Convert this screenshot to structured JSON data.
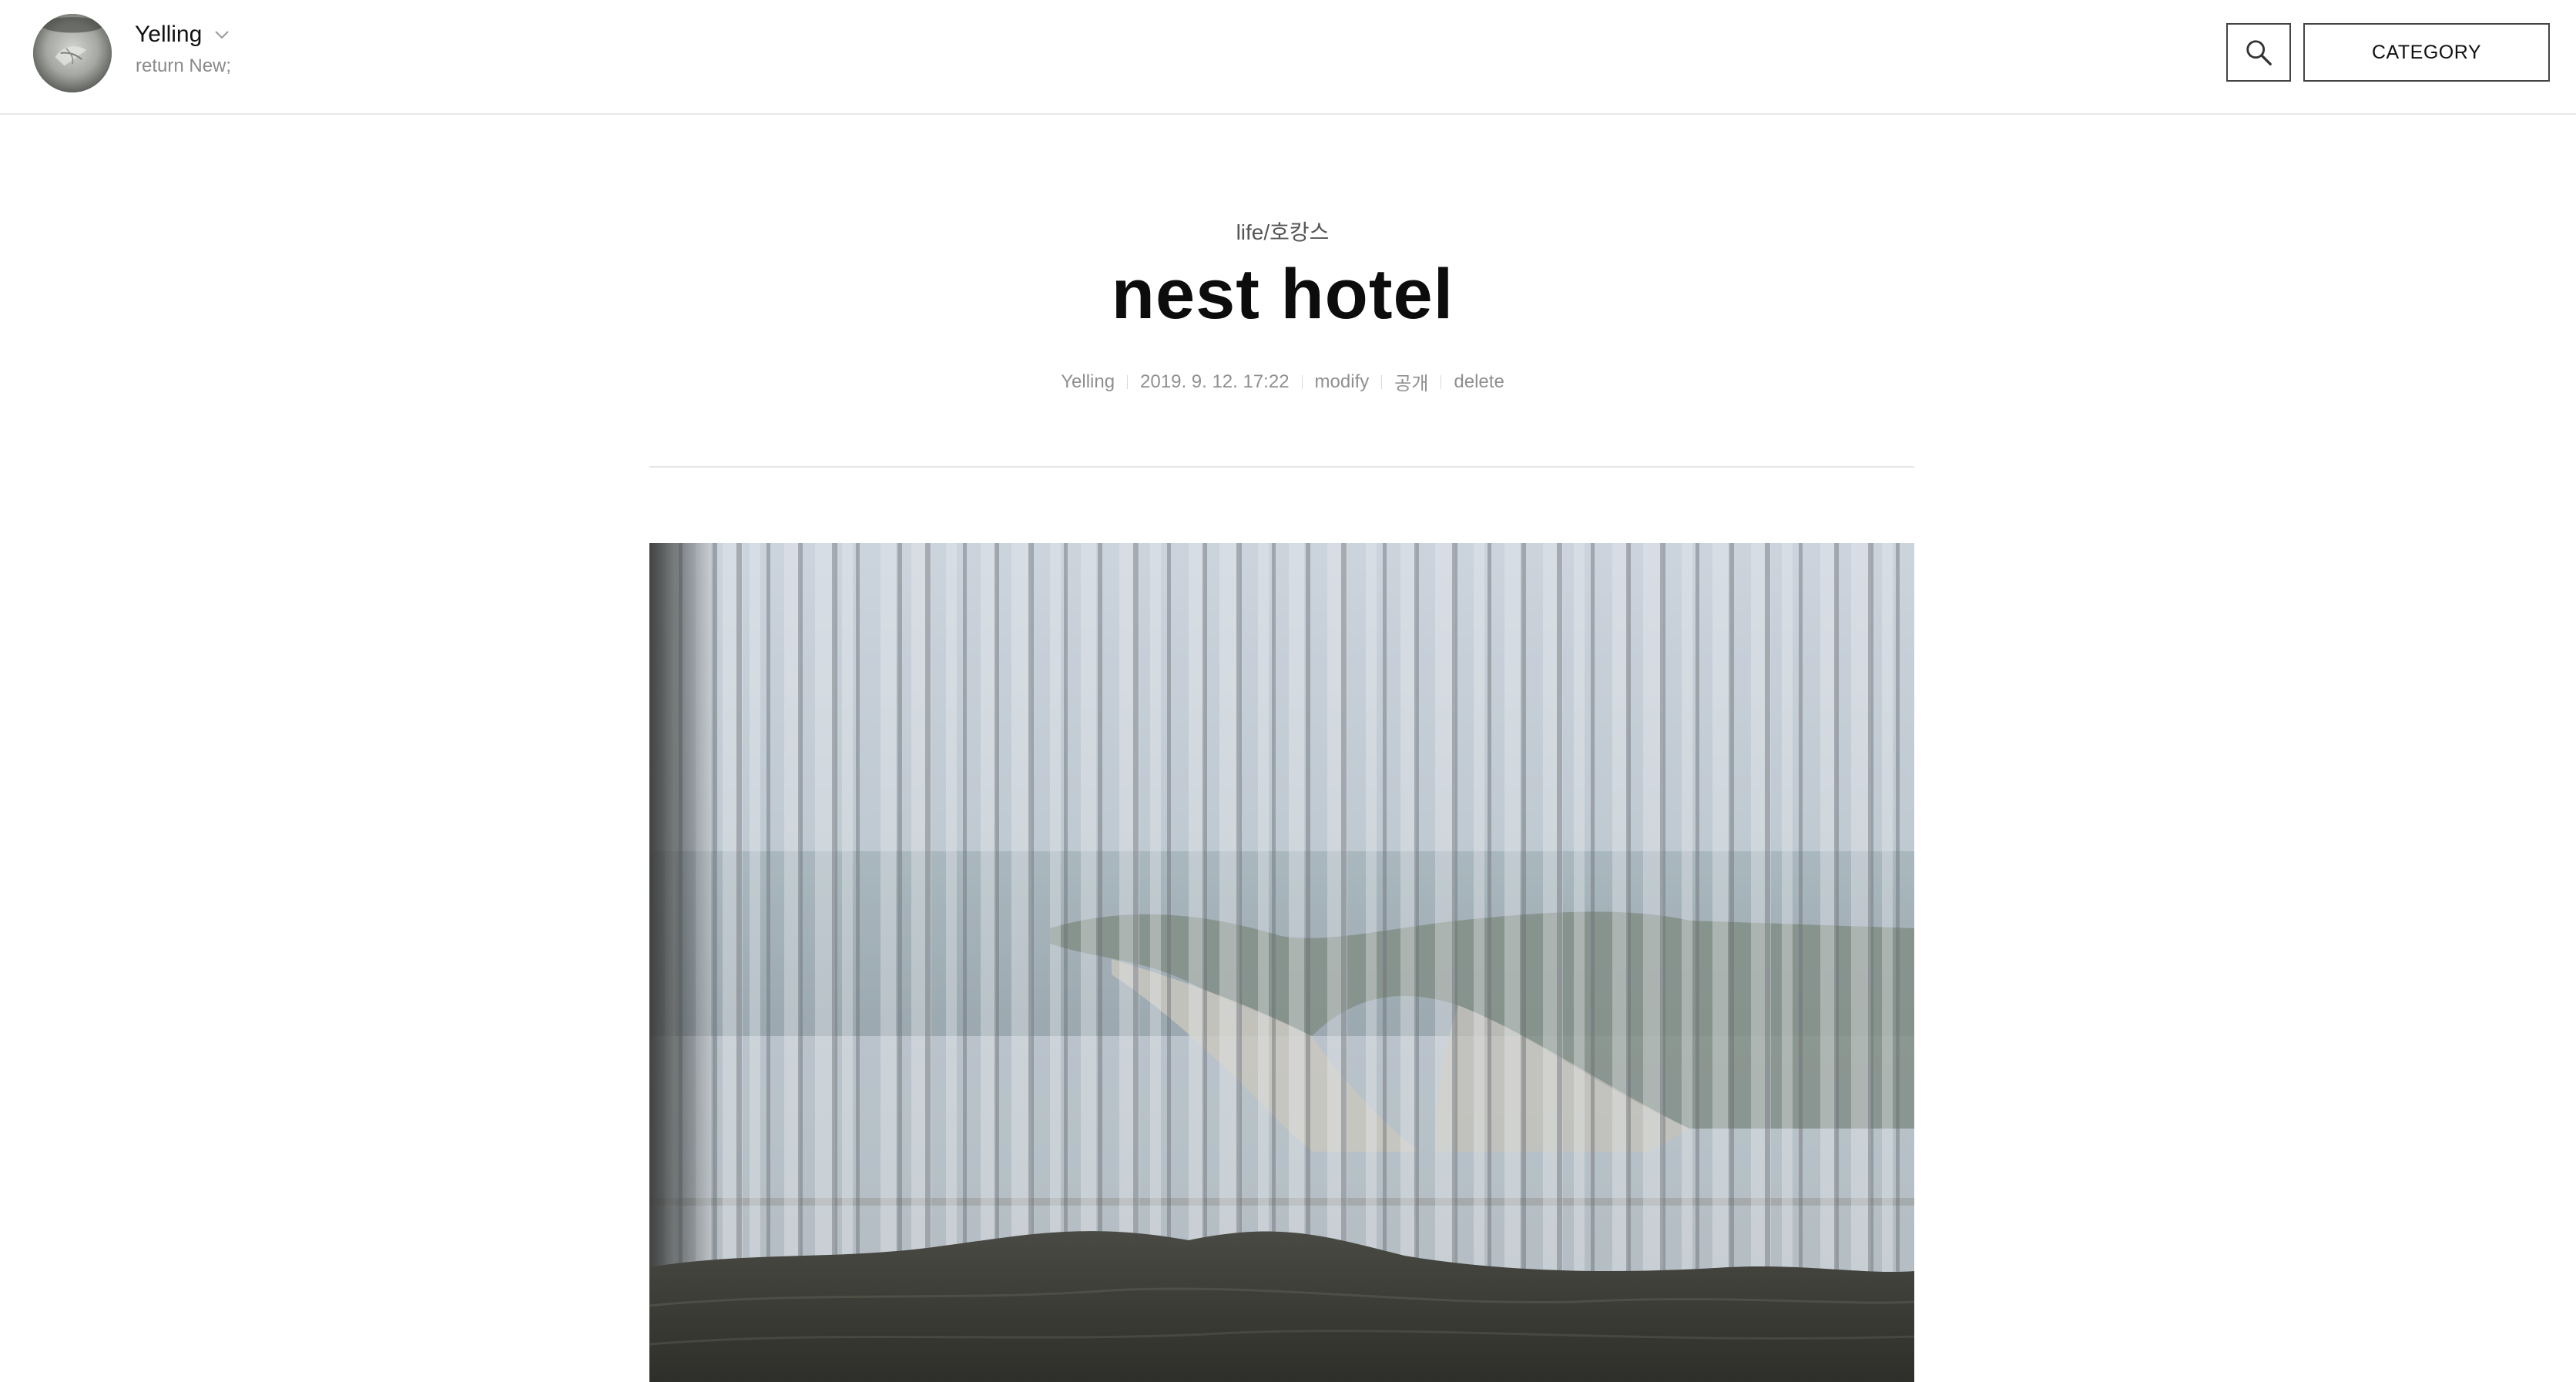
{
  "header": {
    "blog_title": "Yelling",
    "blog_description": "return New;",
    "avatar_icon": "profile-avatar",
    "chevron_icon": "chevron-down-icon",
    "search_icon": "search-icon",
    "category_label": "CATEGORY"
  },
  "post": {
    "category": "life/호캉스",
    "title": "nest hotel",
    "meta": {
      "author": "Yelling",
      "date": "2019. 9. 12. 17:22",
      "modify_label": "modify",
      "visibility": "공개",
      "delete_label": "delete"
    },
    "photo": {
      "subject": "hotel window with sheer curtains overlooking the sea, bed in foreground"
    }
  },
  "colors": {
    "text_primary": "#0c0c0c",
    "text_muted": "#8f8f8f",
    "border": "#444444",
    "divider": "#e6e6e6"
  }
}
